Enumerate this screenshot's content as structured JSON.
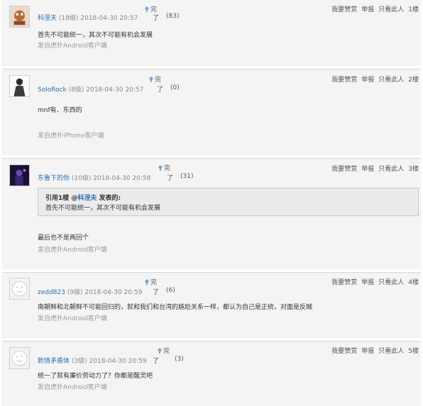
{
  "actions": {
    "like": "我要赞赏",
    "report": "举报",
    "only_this": "只看此人"
  },
  "posts": [
    {
      "username": "科涅夫",
      "level": "(18级)",
      "datetime": "2018-04-30 20:57",
      "like_top": "完",
      "like_bottom": "了",
      "count": "(83)",
      "content": "首先不可能统一，其次不可能有机会发展",
      "source": "发自虎扑Android客户端",
      "floor": "1楼"
    },
    {
      "username": "SoloRock",
      "level": "(8级)",
      "datetime": "2018-04-30 20:57",
      "like_top": "完",
      "like_bottom": "了",
      "count": "(0)",
      "content": "mnf有、东西的",
      "source": "发自虎扑iPhone客户端",
      "floor": "2楼"
    },
    {
      "username": "东鲁下的你",
      "level": "(10级)",
      "datetime": "2018-04-30 20:58",
      "like_top": "完",
      "like_bottom": "了",
      "count": "(31)",
      "quote_prefix": "引用1楼 @",
      "quote_user": "科涅夫",
      "quote_suffix": " 发表的:",
      "quote_text": "首先不可能统一，其次不可能有机会发展",
      "content": "最后也不是两回个",
      "source": "发自虎扑Android客户端",
      "floor": "3楼"
    },
    {
      "username": "zedd823",
      "level": "(9级)",
      "datetime": "2018-04-30 20:59",
      "like_top": "完",
      "like_bottom": "了",
      "count": "(6)",
      "content": "南朝鲜和北朝鲜不可能回归的，就和我们和台湾的尴尬关系一样，都认为自己是正统，对面是反贼",
      "source": "发自虎扑Android客户端",
      "floor": "4楼"
    },
    {
      "username": "新情矛盾体",
      "level": "(3级)",
      "datetime": "2018-04-30 20:59",
      "like_top": "完",
      "like_bottom": "了",
      "count": "(3)",
      "content": "统一了就有廉价劳动力了？你都是醒灵吧",
      "source": "发自虎扑Android客户端",
      "floor": "5楼"
    }
  ]
}
